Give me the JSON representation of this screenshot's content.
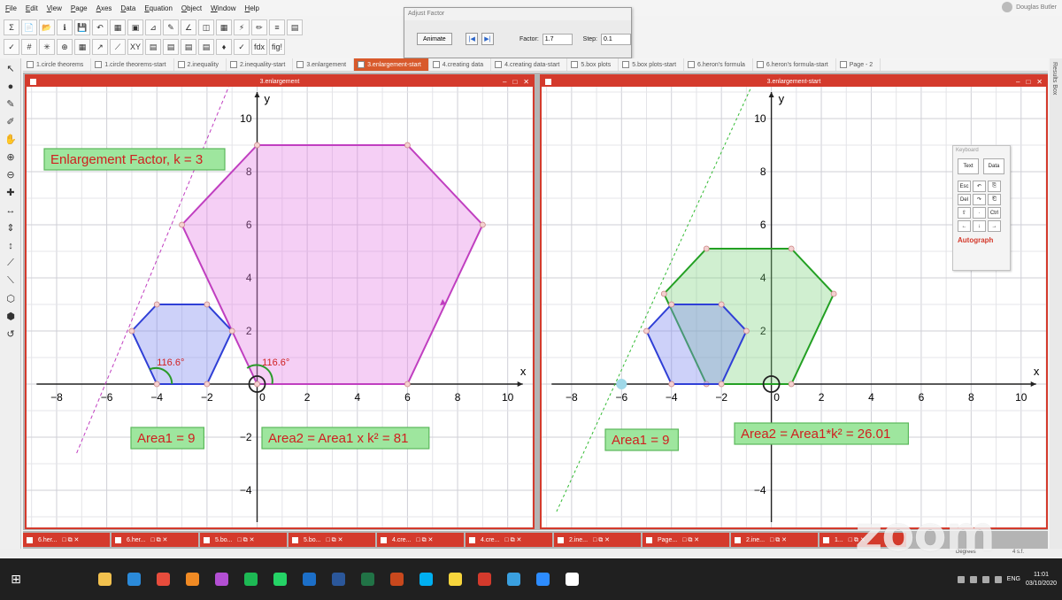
{
  "menu": [
    "File",
    "Edit",
    "View",
    "Page",
    "Axes",
    "Data",
    "Equation",
    "Object",
    "Window",
    "Help"
  ],
  "user": {
    "name": "Douglas Butler"
  },
  "toolbar1": [
    "Σ",
    "📄",
    "📂",
    "ℹ",
    "💾",
    "↶",
    "▦",
    "▣",
    "⊿",
    "✎",
    "∠",
    "◫",
    "▦",
    "⚡",
    "✏",
    "≡",
    "▤"
  ],
  "toolbar2": [
    "✓",
    "#",
    "✳",
    "⊕",
    "▦",
    "↗",
    "⟋",
    "XY",
    "▤",
    "▤",
    "▤",
    "▤",
    "♦",
    "✓",
    "fdx",
    "fig!"
  ],
  "adjust_factor": {
    "title": "Adjust Factor",
    "animate_label": "Animate",
    "factor_label": "Factor:",
    "factor_value": "1.7",
    "step_label": "Step:",
    "step_value": "0.1"
  },
  "left_tools": [
    "↖",
    "●",
    "✎",
    "✐",
    "✋",
    "⊕",
    "⊖",
    "✚",
    "↔",
    "⇕",
    "↕",
    "⟋",
    "⟍",
    "⬡",
    "⬢",
    "↺"
  ],
  "results_box_label": "Results Box",
  "tabs": [
    {
      "label": "1.circle theorems",
      "active": false
    },
    {
      "label": "1.circle theorems-start",
      "active": false
    },
    {
      "label": "2.inequality",
      "active": false
    },
    {
      "label": "2.inequality-start",
      "active": false
    },
    {
      "label": "3.enlargement",
      "active": false
    },
    {
      "label": "3.enlargement-start",
      "active": true
    },
    {
      "label": "4.creating data",
      "active": false
    },
    {
      "label": "4.creating data-start",
      "active": false
    },
    {
      "label": "5.box plots",
      "active": false
    },
    {
      "label": "5.box plots-start",
      "active": false
    },
    {
      "label": "6.heron's formula",
      "active": false
    },
    {
      "label": "6.heron's formula-start",
      "active": false
    },
    {
      "label": "Page - 2",
      "active": false
    }
  ],
  "window_controls": {
    "minimize": "–",
    "restore": "□",
    "close": "✕"
  },
  "left_window": {
    "title": "3.enlargement",
    "axis_x_label": "x",
    "axis_y_label": "y",
    "x_ticks": [
      "−8",
      "−6",
      "−4",
      "−2",
      "0",
      "2",
      "4",
      "6",
      "8",
      "10"
    ],
    "y_ticks": [
      "10",
      "8",
      "6",
      "4",
      "2",
      "−2",
      "−4"
    ],
    "label_factor": "Enlargement Factor, k = 3",
    "label_area1": "Area1 = 9",
    "label_area2": "Area2 = Area1 x k² = 81",
    "angle1": "116.6°",
    "angle2": "116.6°",
    "k": 3,
    "center": [
      -6,
      0
    ],
    "object_hexagon": [
      [
        -5,
        2
      ],
      [
        -4,
        3
      ],
      [
        -2,
        3
      ],
      [
        -1,
        2
      ],
      [
        -2,
        0
      ],
      [
        -4,
        0
      ]
    ],
    "image_hexagon": [
      [
        -3,
        6
      ],
      [
        0,
        9
      ],
      [
        6,
        9
      ],
      [
        9,
        6
      ],
      [
        6,
        0
      ],
      [
        0,
        0
      ]
    ],
    "colors": {
      "object": "#2f3fd6",
      "image": "#c03fc0",
      "label_fill": "#8fe28f",
      "label_border": "#5bb85b",
      "label_text": "#d02020"
    }
  },
  "right_window": {
    "title": "3.enlargement-start",
    "axis_x_label": "x",
    "axis_y_label": "y",
    "x_ticks": [
      "−8",
      "−6",
      "−4",
      "−2",
      "0",
      "2",
      "4",
      "6",
      "8",
      "10"
    ],
    "y_ticks": [
      "10",
      "8",
      "6",
      "4",
      "2",
      "−2",
      "−4"
    ],
    "label_area1": "Area1 = 9",
    "label_area2": "Area2 = Area1*k² = 26.01",
    "k": 1.7,
    "center": [
      -6,
      0
    ],
    "object_hexagon": [
      [
        -5,
        2
      ],
      [
        -4,
        3
      ],
      [
        -2,
        3
      ],
      [
        -1,
        2
      ],
      [
        -2,
        0
      ],
      [
        -4,
        0
      ]
    ],
    "image_hexagon": [
      [
        -4.3,
        3.4
      ],
      [
        -2.6,
        5.1
      ],
      [
        0.8,
        5.1
      ],
      [
        2.5,
        3.4
      ],
      [
        0.8,
        0
      ],
      [
        -2.6,
        0
      ]
    ],
    "colors": {
      "object": "#2f3fd6",
      "image": "#23a023"
    }
  },
  "keyboard": {
    "title": "Keyboard",
    "big_keys": [
      "Text",
      "Data"
    ],
    "keys": [
      "Esc",
      "↶",
      "⎘",
      "Del",
      "↷",
      "⎗",
      "⇧",
      "·",
      "Ctrl",
      "←",
      "↓",
      "→"
    ],
    "brand": "Autograph"
  },
  "bottom_tabs": [
    "6.her...",
    "6.her...",
    "5.bo...",
    "5.bo...",
    "4.cre...",
    "4.cre...",
    "2.ine...",
    "Page...",
    "2.ine...",
    "1..."
  ],
  "status": {
    "angle_mode": "Degrees",
    "sig_figs": "4 s.f."
  },
  "zoom_watermark": "zoom",
  "taskbar": {
    "start_icon": "windows-icon",
    "apps": [
      {
        "name": "search",
        "color": "#202020"
      },
      {
        "name": "task-view",
        "color": "#202020"
      },
      {
        "name": "file-explorer",
        "color": "#f2c14e"
      },
      {
        "name": "edge",
        "color": "#2b8ad9"
      },
      {
        "name": "chrome",
        "color": "#e74c3c"
      },
      {
        "name": "firefox",
        "color": "#f08a24"
      },
      {
        "name": "unknown-app",
        "color": "#b34fd3"
      },
      {
        "name": "spotify",
        "color": "#1db954"
      },
      {
        "name": "whatsapp",
        "color": "#25d366"
      },
      {
        "name": "outlook",
        "color": "#1c6fc8"
      },
      {
        "name": "word",
        "color": "#2b579a"
      },
      {
        "name": "excel",
        "color": "#217346"
      },
      {
        "name": "powerpoint",
        "color": "#c8481d"
      },
      {
        "name": "skype",
        "color": "#00aff0"
      },
      {
        "name": "sticky-notes",
        "color": "#f7d53c"
      },
      {
        "name": "autograph",
        "color": "#d43a2c"
      },
      {
        "name": "browser",
        "color": "#3aa0e0"
      },
      {
        "name": "zoom",
        "color": "#2d8cff"
      },
      {
        "name": "clock",
        "color": "#ffffff"
      }
    ],
    "lang": "ENG",
    "time": "11:01",
    "date": "03/10/2020"
  }
}
